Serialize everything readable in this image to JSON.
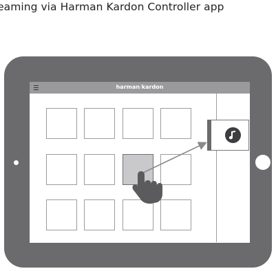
{
  "caption": "reaming via Harman Kardon Controller app",
  "app": {
    "brand_left": "harman",
    "brand_sep": "/",
    "brand_right": "kardon",
    "menu_icon": "hamburger-menu-icon"
  },
  "device": {
    "icon": "music-note-icon"
  },
  "gesture": {
    "icon": "pointing-hand-icon",
    "action": "drag-tile-to-device"
  },
  "grid": {
    "rows": 3,
    "cols": 4,
    "active_row": 1,
    "active_col": 2
  },
  "colors": {
    "tablet": "#6b6b6d",
    "appbar": "#9a9a9d",
    "tile_border": "#9c9c9c",
    "active_tile": "#c9c9cb",
    "arrow": "#8a8a8a"
  }
}
